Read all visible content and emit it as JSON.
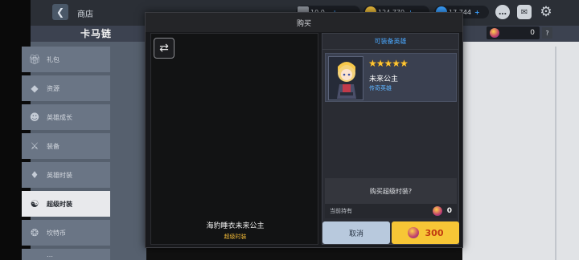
{
  "header": {
    "title": "商店",
    "logo": "卡马链"
  },
  "currencies": [
    {
      "name": "ticket",
      "value": "10,0..",
      "color": "#8a8f98"
    },
    {
      "name": "gold",
      "value": "124,770",
      "color": "#e8b93a"
    },
    {
      "name": "gem",
      "value": "17,744",
      "color": "#3aa0ff"
    }
  ],
  "top_icons": [
    "chat-icon",
    "mail-icon",
    "settings-icon"
  ],
  "sidebar": {
    "items": [
      {
        "label": "礼包",
        "icon": "gift-icon"
      },
      {
        "label": "资源",
        "icon": "diamond-icon"
      },
      {
        "label": "英雄成长",
        "icon": "hero-growth-icon"
      },
      {
        "label": "装备",
        "icon": "equipment-icon"
      },
      {
        "label": "英雄时装",
        "icon": "hero-costume-icon"
      },
      {
        "label": "超级时装",
        "icon": "super-costume-icon",
        "active": true
      },
      {
        "label": "坎特币",
        "icon": "coin-icon"
      },
      {
        "label": "…",
        "icon": "more-icon"
      }
    ]
  },
  "right_currency": {
    "value": "0",
    "help": "?"
  },
  "modal": {
    "title": "购买",
    "preview": {
      "swap_icon": "⇄",
      "name": "海豹睡衣未来公主",
      "type": "超级时装"
    },
    "panel": {
      "title": "可装备英雄",
      "hero": {
        "stars": 5,
        "name": "未来公主",
        "rank": "传奇英雄"
      },
      "buy_prompt": "购买超级时装?",
      "owned_label": "当前持有",
      "owned_value": "0"
    },
    "cancel_label": "取消",
    "price": "300"
  },
  "colors": {
    "gem_accent": "#c2416b",
    "buy_button": "#f7c636",
    "cancel_button": "#b8c9dd",
    "link_blue": "#4aa8ff",
    "star_gold": "#ffc733"
  }
}
